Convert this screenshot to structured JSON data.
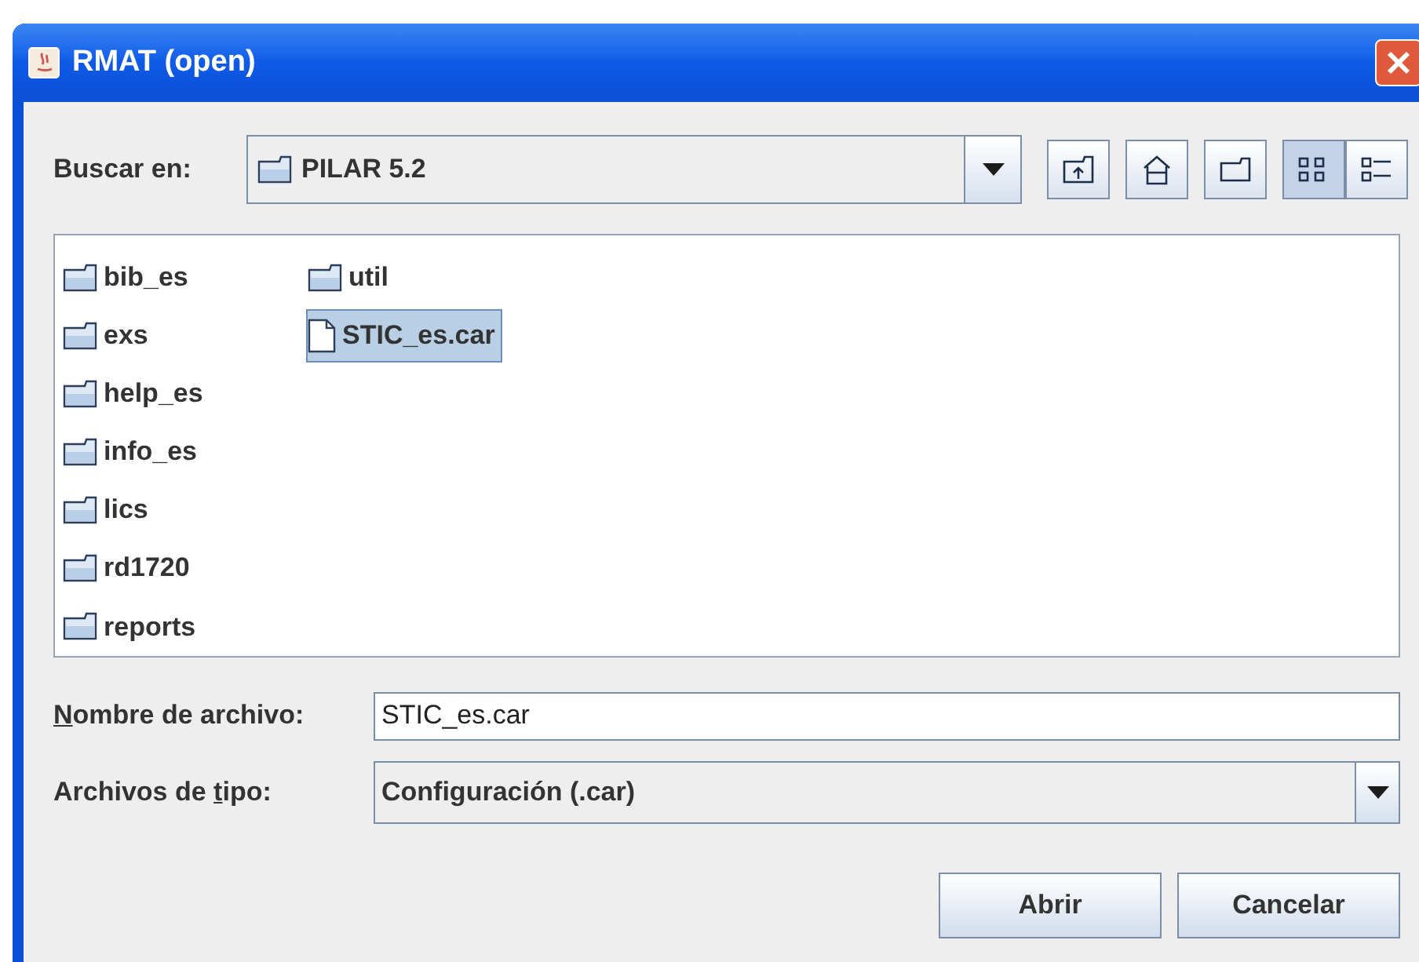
{
  "window": {
    "title": "RMAT (open)"
  },
  "look_in": {
    "label": "Buscar en:",
    "value": "PILAR 5.2"
  },
  "toolbar": [
    {
      "kind": "up",
      "selected": false
    },
    {
      "kind": "home",
      "selected": false
    },
    {
      "kind": "new_folder",
      "selected": false
    },
    {
      "kind": "list",
      "selected": true
    },
    {
      "kind": "details",
      "selected": false
    }
  ],
  "files": [
    {
      "name": "bib_es",
      "kind": "folder",
      "selected": false
    },
    {
      "name": "exs",
      "kind": "folder",
      "selected": false
    },
    {
      "name": "help_es",
      "kind": "folder",
      "selected": false
    },
    {
      "name": "info_es",
      "kind": "folder",
      "selected": false
    },
    {
      "name": "lics",
      "kind": "folder",
      "selected": false
    },
    {
      "name": "rd1720",
      "kind": "folder",
      "selected": false
    },
    {
      "name": "reports",
      "kind": "folder",
      "selected": false
    },
    {
      "name": "util",
      "kind": "folder",
      "selected": false
    },
    {
      "name": "STIC_es.car",
      "kind": "file",
      "selected": true
    }
  ],
  "file_name": {
    "label": {
      "mnemonic": "N",
      "after": "ombre de archivo:"
    },
    "value": "STIC_es.car"
  },
  "file_type": {
    "label": {
      "before": "Archivos de ",
      "mnemonic": "t",
      "after": "ipo:"
    },
    "value": "Configuración (.car)"
  },
  "buttons": [
    "Abrir",
    "Cancelar"
  ]
}
